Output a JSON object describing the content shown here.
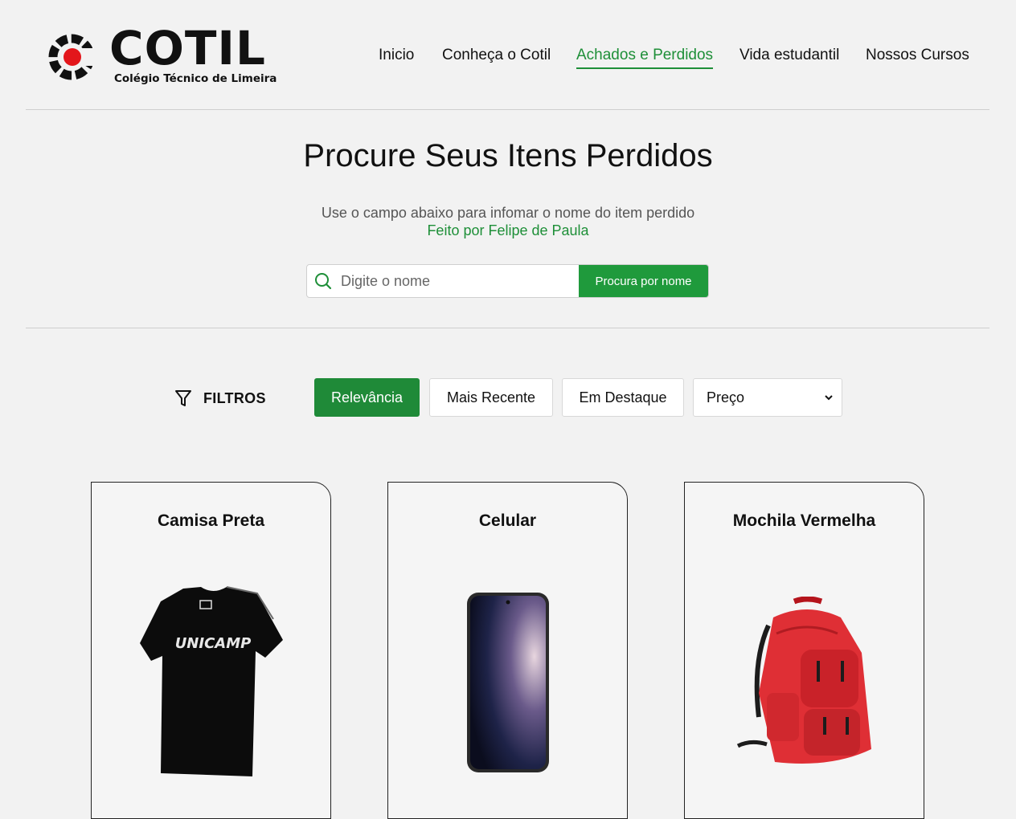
{
  "brand": {
    "name": "COTIL",
    "subtitle": "Colégio Técnico de Limeira"
  },
  "nav": {
    "items": [
      {
        "label": "Inicio",
        "active": false
      },
      {
        "label": "Conheça o Cotil",
        "active": false
      },
      {
        "label": "Achados e Perdidos",
        "active": true
      },
      {
        "label": "Vida estudantil",
        "active": false
      },
      {
        "label": "Nossos Cursos",
        "active": false
      }
    ]
  },
  "hero": {
    "title": "Procure Seus Itens Perdidos",
    "subtitle": "Use o campo abaixo para infomar o nome do item perdido",
    "credit": "Feito por Felipe de Paula"
  },
  "search": {
    "placeholder": "Digite o nome",
    "value": "",
    "button_label": "Procura por nome"
  },
  "filters": {
    "label": "FILTROS",
    "buttons": [
      {
        "label": "Relevância",
        "active": true
      },
      {
        "label": "Mais Recente",
        "active": false
      },
      {
        "label": "Em Destaque",
        "active": false
      }
    ],
    "select_value": "Preço"
  },
  "items": [
    {
      "name": "Camisa Preta",
      "image": "black-tshirt",
      "print": "UNICAMP"
    },
    {
      "name": "Celular",
      "image": "smartphone"
    },
    {
      "name": "Mochila Vermelha",
      "image": "red-backpack"
    }
  ],
  "colors": {
    "accent": "#1e8f38",
    "button_green": "#1f9a3c",
    "background": "#f2f2f2",
    "logo_red": "#e3161b"
  }
}
